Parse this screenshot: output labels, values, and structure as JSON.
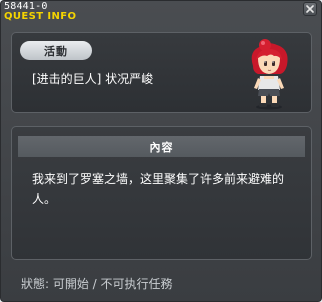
{
  "window": {
    "quest_id": "58441-0",
    "title": "QUEST INFO"
  },
  "quest": {
    "category_badge": "活動",
    "name": "[进击的巨人] 状况严峻"
  },
  "content": {
    "header": "內容",
    "text": "我来到了罗塞之墙，这里聚集了许多前来避难的人。"
  },
  "status": {
    "text": "狀態: 可開始 / 不可执行任務"
  },
  "colors": {
    "title_accent": "#f5d400",
    "background": "#3a3d41"
  },
  "icons": {
    "close": "close-icon",
    "character": "character-portrait"
  }
}
